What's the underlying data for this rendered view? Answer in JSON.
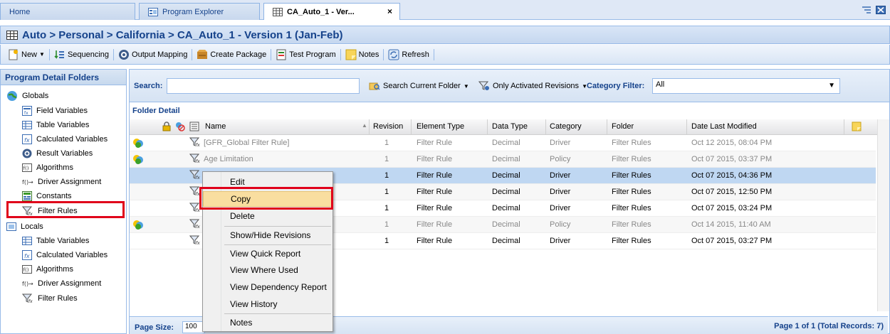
{
  "tabs": [
    {
      "label": "Home"
    },
    {
      "label": "Program Explorer"
    },
    {
      "label": "CA_Auto_1 - Ver...",
      "close": "×"
    }
  ],
  "title": "Auto > Personal > California > CA_Auto_1 - Version 1 (Jan-Feb)",
  "toolbar": {
    "new": "New",
    "sequencing": "Sequencing",
    "output_mapping": "Output Mapping",
    "create_package": "Create Package",
    "test_program": "Test Program",
    "notes": "Notes",
    "refresh": "Refresh"
  },
  "left_panel": {
    "header": "Program Detail Folders",
    "globals": "Globals",
    "global_items": [
      "Field Variables",
      "Table Variables",
      "Calculated Variables",
      "Result Variables",
      "Algorithms",
      "Driver Assignment",
      "Constants",
      "Filter Rules"
    ],
    "locals": "Locals",
    "local_items": [
      "Table Variables",
      "Calculated Variables",
      "Algorithms",
      "Driver Assignment",
      "Filter Rules"
    ],
    "selected_item": "Filter Rules"
  },
  "search": {
    "label": "Search:",
    "value": "",
    "current_folder": "Search Current Folder",
    "activated": "Only Activated Revisions",
    "category_label": "Category Filter:",
    "category_value": "All"
  },
  "folder_detail": {
    "header": "Folder Detail",
    "columns": [
      "Name",
      "Revision",
      "Element Type",
      "Data Type",
      "Category",
      "Folder",
      "Date Last Modified"
    ],
    "rows": [
      {
        "name": "[GFR_Global Filter Rule]",
        "revision": "1",
        "element_type": "Filter Rule",
        "data_type": "Decimal",
        "category": "Driver",
        "folder": "Filter Rules",
        "date": "Oct 12 2015, 08:04 PM",
        "dim": true,
        "flag": true
      },
      {
        "name": "Age Limitation",
        "revision": "1",
        "element_type": "Filter Rule",
        "data_type": "Decimal",
        "category": "Policy",
        "folder": "Filter Rules",
        "date": "Oct 07 2015, 03:37 PM",
        "dim": true,
        "flag": true
      },
      {
        "name": "",
        "revision": "1",
        "element_type": "Filter Rule",
        "data_type": "Decimal",
        "category": "Driver",
        "folder": "Filter Rules",
        "date": "Oct 07 2015, 04:36 PM",
        "dim": false,
        "flag": false,
        "selected": true
      },
      {
        "name": "",
        "revision": "1",
        "element_type": "Filter Rule",
        "data_type": "Decimal",
        "category": "Driver",
        "folder": "Filter Rules",
        "date": "Oct 07 2015, 12:50 PM",
        "dim": false,
        "flag": false
      },
      {
        "name": "",
        "revision": "1",
        "element_type": "Filter Rule",
        "data_type": "Decimal",
        "category": "Driver",
        "folder": "Filter Rules",
        "date": "Oct 07 2015, 03:24 PM",
        "dim": false,
        "flag": false
      },
      {
        "name": "",
        "revision": "1",
        "element_type": "Filter Rule",
        "data_type": "Decimal",
        "category": "Policy",
        "folder": "Filter Rules",
        "date": "Oct 14 2015, 11:40 AM",
        "dim": true,
        "flag": true
      },
      {
        "name": "",
        "revision": "1",
        "element_type": "Filter Rule",
        "data_type": "Decimal",
        "category": "Driver",
        "folder": "Filter Rules",
        "date": "Oct 07 2015, 03:27 PM",
        "dim": false,
        "flag": false
      }
    ]
  },
  "context_menu": {
    "items": [
      "Edit",
      "Copy",
      "Delete",
      "Show/Hide Revisions",
      "View Quick Report",
      "View Where Used",
      "View Dependency Report",
      "View History",
      "Notes"
    ],
    "highlighted": "Copy"
  },
  "footer": {
    "page_size_label": "Page Size:",
    "page_size_value": "100",
    "page_info": "Page 1 of 1 (Total Records: 7)"
  },
  "colors": {
    "accent": "#15428b",
    "highlight_box": "#e0001a",
    "selected_row": "#bfd7f2",
    "menu_hover": "#f9dea0"
  }
}
